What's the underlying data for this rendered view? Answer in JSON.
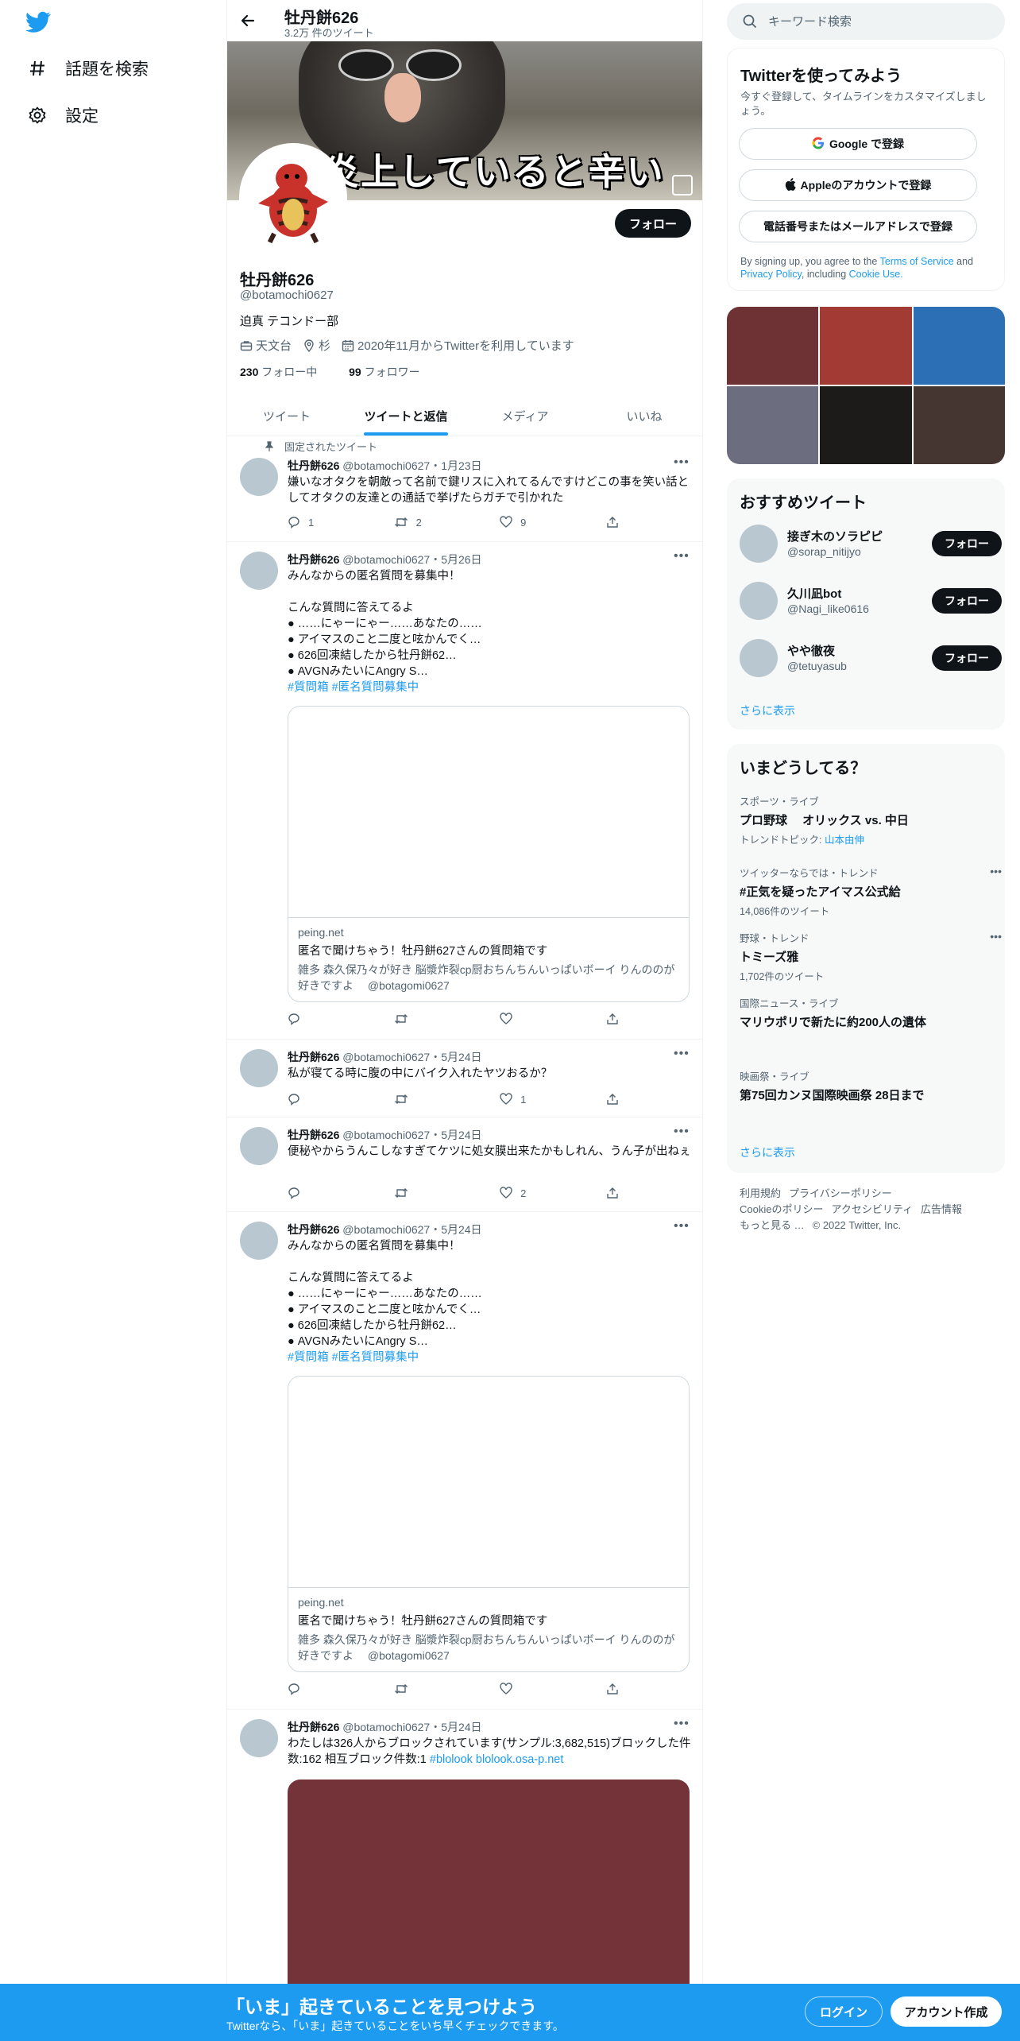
{
  "nav": {
    "logo_icon": "twitter-bird-icon",
    "explore_label": "話題を検索",
    "settings_label": "設定"
  },
  "header": {
    "name": "牡丹餅626",
    "tweet_count": "3.2万 件のツイート"
  },
  "banner": {
    "caption": "炎上していると辛い"
  },
  "profile": {
    "follow_label": "フォロー",
    "name": "牡丹餅626",
    "handle": "@botamochi0627",
    "bio": "迫真 テコンドー部",
    "work": "天文台",
    "location": "杉",
    "joined": "2020年11月からTwitterを利用しています",
    "following_count": "230",
    "following_label": "フォロー中",
    "followers_count": "99",
    "followers_label": "フォロワー"
  },
  "tabs": [
    "ツイート",
    "ツイートと返信",
    "メディア",
    "いいね"
  ],
  "pinned_label": "固定されたツイート",
  "tweets": [
    {
      "name": "牡丹餅626",
      "handle": "@botamochi0627",
      "date": "・1月23日",
      "text": "嫌いなオタクを朝敵って名前で鍵リスに入れてるんですけどこの事を笑い話としてオタクの友達との通話で挙げたらガチで引かれた",
      "reply": "1",
      "retweet": "2",
      "like": "9"
    },
    {
      "name": "牡丹餅626",
      "handle": "@botamochi0627",
      "date": "・5月26日",
      "text": "みんなからの匿名質問を募集中！\n\nこんな質問に答えてるよ\n● ……にゃーにゃー……あなたの……\n● アイマスのこと二度と呟かんでく…\n● 626回凍結したから牡丹餅62…\n● AVGNみたいにAngry S…",
      "tags": "#質問箱 #匿名質問募集中",
      "card_domain": "peing.net",
      "card_title": "匿名で聞けちゃう！牡丹餅627さんの質問箱です",
      "card_desc": "雑多 森久保乃々が好き 脳漿炸裂cp厨おちんちんいっぱいボーイ りんののが好きですよ　 @botagomi0627",
      "reply": "",
      "retweet": "",
      "like": ""
    },
    {
      "name": "牡丹餅626",
      "handle": "@botamochi0627",
      "date": "・5月24日",
      "text": "私が寝てる時に腹の中にバイク入れたヤツおるか？",
      "reply": "",
      "retweet": "",
      "like": "1"
    },
    {
      "name": "牡丹餅626",
      "handle": "@botamochi0627",
      "date": "・5月24日",
      "text": "便秘やからうんこしなすぎてケツに処女膜出来たかもしれん、うん子が出ねぇ",
      "reply": "",
      "retweet": "",
      "like": "2"
    },
    {
      "name": "牡丹餅626",
      "handle": "@botamochi0627",
      "date": "・5月24日",
      "text": "みんなからの匿名質問を募集中！\n\nこんな質問に答えてるよ\n● ……にゃーにゃー……あなたの……\n● アイマスのこと二度と呟かんでく…\n● 626回凍結したから牡丹餅62…\n● AVGNみたいにAngry S…",
      "tags": "#質問箱 #匿名質問募集中",
      "card_domain": "peing.net",
      "card_title": "匿名で聞けちゃう！牡丹餅627さんの質問箱です",
      "card_desc": "雑多 森久保乃々が好き 脳漿炸裂cp厨おちんちんいっぱいボーイ りんののが好きですよ　 @botagomi0627",
      "reply": "",
      "retweet": "",
      "like": ""
    },
    {
      "name": "牡丹餅626",
      "handle": "@botamochi0627",
      "date": "・5月24日",
      "text": "わたしは326人からブロックされています(サンプル:3,682,515)ブロックした件数:162 相互ブロック件数:1 ",
      "tags": "#blolook blolook.osa-p.net"
    }
  ],
  "search": {
    "placeholder": "キーワード検索"
  },
  "signup": {
    "title": "Twitterを使ってみよう",
    "subtitle": "今すぐ登録して、タイムラインをカスタマイズしましょう。",
    "google": "Google で登録",
    "apple": "Appleのアカウントで登録",
    "phone": "電話番号またはメールアドレスで登録",
    "legal_prefix": "By signing up, you agree to the ",
    "tos": "Terms of Service",
    "and": " and ",
    "privacy": "Privacy Policy",
    "including": ", including ",
    "cookie": "Cookie Use."
  },
  "mosaic_colors": [
    "#6e3134",
    "#a23b34",
    "#2d6fb4",
    "#6c6e80",
    "#1d1a1a",
    "#463632"
  ],
  "who_to_follow": {
    "title": "おすすめツイート",
    "users": [
      {
        "name": "接ぎ木のソラピピ",
        "handle": "@sorap_nitijyo",
        "button": "フォロー"
      },
      {
        "name": "久川凪bot",
        "handle": "@Nagi_like0616",
        "button": "フォロー"
      },
      {
        "name": "やや徹夜",
        "handle": "@tetuyasub",
        "button": "フォロー"
      }
    ],
    "more": "さらに表示"
  },
  "trends": {
    "title": "いまどうしてる？",
    "items": [
      {
        "category": "スポーツ・ライブ",
        "name": "プロ野球　 オリックス vs. 中日",
        "extra_prefix": "トレンドトピック: ",
        "extra_link": "山本由伸"
      },
      {
        "category": "ツイッターならでは・トレンド",
        "name": "#正気を疑ったアイマス公式給",
        "extra": "14,086件のツイート"
      },
      {
        "category": "野球・トレンド",
        "name": "トミーズ雅",
        "extra": "1,702件のツイート"
      },
      {
        "category": "国際ニュース・ライブ",
        "name": "マリウポリで新たに約200人の遺体"
      },
      {
        "category": "映画祭・ライブ",
        "name": "第75回カンヌ国際映画祭 28日まで"
      }
    ],
    "more": "さらに表示"
  },
  "footer": {
    "terms": "利用規約",
    "privacy": "プライバシーポリシー",
    "cookie": "Cookieのポリシー",
    "accessibility": "アクセシビリティ",
    "ads": "広告情報",
    "more": "もっと見る …",
    "copyright": "© 2022 Twitter, Inc."
  },
  "bottom_bar": {
    "headline": "「いま」起きていることを見つけよう",
    "sub": "Twitterなら、「いま」起きていることをいち早くチェックできます。",
    "login": "ログイン",
    "signup": "アカウント作成"
  }
}
